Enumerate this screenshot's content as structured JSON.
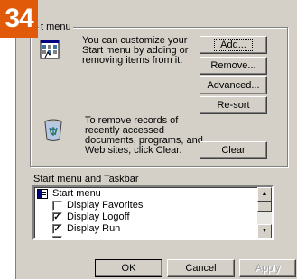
{
  "badge": "34",
  "start_menu_group": {
    "title": "t menu",
    "customize_text": [
      "You can customize your",
      "Start menu by adding or",
      "removing items from it."
    ],
    "add_label": "Add...",
    "remove_label": "Remove...",
    "advanced_label": "Advanced...",
    "resort_label": "Re-sort",
    "clear_records_text": [
      "To remove records of",
      "recently accessed",
      "documents, programs, and",
      "Web sites,  click Clear."
    ],
    "clear_label": "Clear"
  },
  "taskbar_section": {
    "label": "Start menu and Taskbar",
    "items": [
      {
        "label": "Start menu",
        "type": "folder"
      },
      {
        "label": "Display Favorites",
        "checked": false
      },
      {
        "label": "Display Logoff",
        "checked": true
      },
      {
        "label": "Display Run",
        "checked": true
      }
    ]
  },
  "footer": {
    "ok_label": "OK",
    "cancel_label": "Cancel",
    "apply_label": "Apply"
  }
}
